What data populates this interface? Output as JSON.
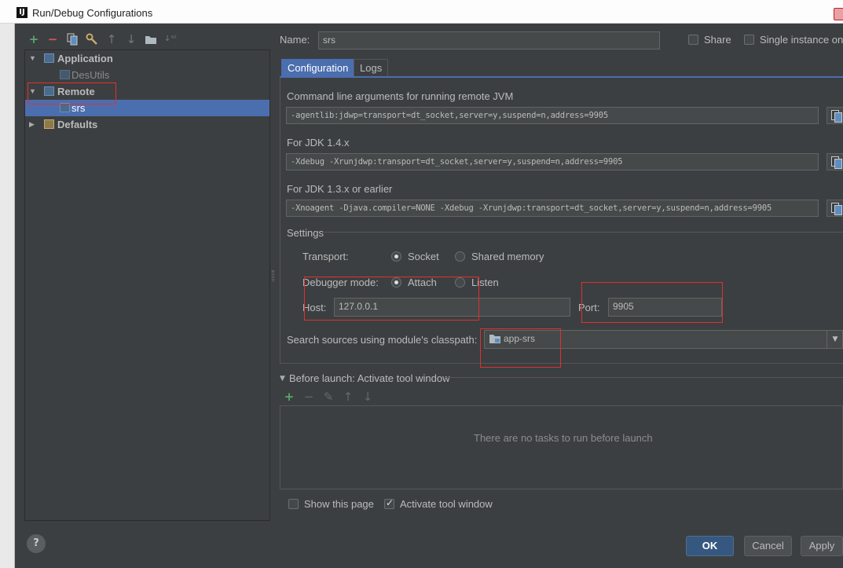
{
  "window": {
    "title": "Run/Debug Configurations",
    "app_icon": "IJ"
  },
  "toolbar": {
    "icons": [
      "add-icon",
      "remove-icon",
      "copy-icon",
      "wrench-icon",
      "arrow-up-icon",
      "arrow-down-icon",
      "folder-icon",
      "sort-icon"
    ]
  },
  "tree": {
    "items": [
      {
        "label": "Application",
        "bold": true
      },
      {
        "label": "DesUtils",
        "bold": false
      },
      {
        "label": "Remote",
        "bold": true
      },
      {
        "label": "srs",
        "bold": false,
        "selected": true
      },
      {
        "label": "Defaults",
        "bold": true
      }
    ]
  },
  "config": {
    "name_label": "Name:",
    "name_value": "srs",
    "share_label": "Share",
    "single_instance_label": "Single instance only",
    "tabs": [
      "Configuration",
      "Logs"
    ],
    "cmdline_label": "Command line arguments for running remote JVM",
    "cmdline_value": "-agentlib:jdwp=transport=dt_socket,server=y,suspend=n,address=9905",
    "jdk14_label": "For JDK 1.4.x",
    "jdk14_value": "-Xdebug -Xrunjdwp:transport=dt_socket,server=y,suspend=n,address=9905",
    "jdk13_label": "For JDK 1.3.x or earlier",
    "jdk13_value": "-Xnoagent -Djava.compiler=NONE -Xdebug -Xrunjdwp:transport=dt_socket,server=y,suspend=n,address=9905",
    "settings_label": "Settings",
    "transport_label": "Transport:",
    "transport_socket": "Socket",
    "transport_shared": "Shared memory",
    "debugger_mode_label": "Debugger mode:",
    "mode_attach": "Attach",
    "mode_listen": "Listen",
    "host_label": "Host:",
    "host_value": "127.0.0.1",
    "port_label": "Port:",
    "port_value": "9905",
    "classpath_label": "Search sources using module's classpath:",
    "classpath_value": "app-srs"
  },
  "before_launch": {
    "title": "Before launch: Activate tool window",
    "empty_text": "There are no tasks to run before launch",
    "show_page_label": "Show this page",
    "activate_label": "Activate tool window"
  },
  "buttons": {
    "ok": "OK",
    "cancel": "Cancel",
    "apply": "Apply",
    "help": "?"
  },
  "colors": {
    "accent": "#4b6eaf",
    "annotation": "#e0302f",
    "background": "#3c3f41"
  }
}
